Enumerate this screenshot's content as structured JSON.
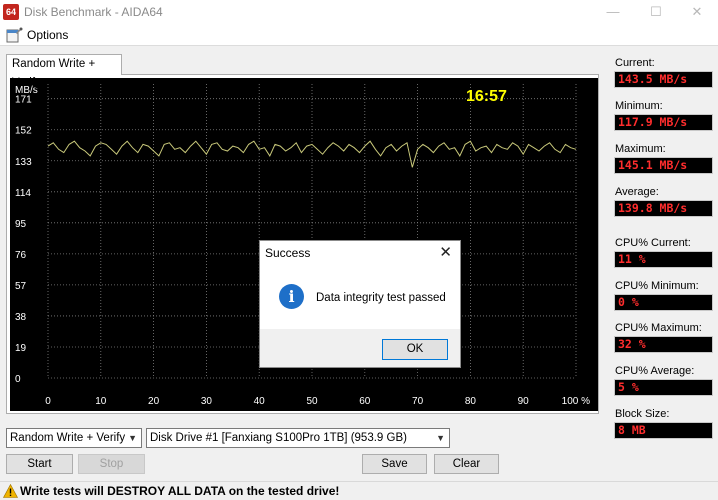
{
  "window": {
    "title": "Disk Benchmark - AIDA64",
    "icon_text": "64"
  },
  "menu": {
    "options_label": "Options"
  },
  "tab": {
    "label": "Random Write + Verify"
  },
  "chart_data": {
    "type": "line",
    "title": "",
    "xlabel": "",
    "ylabel": "MB/s",
    "x_ticks": [
      "0",
      "10",
      "20",
      "30",
      "40",
      "50",
      "60",
      "70",
      "80",
      "90",
      "100 %"
    ],
    "y_ticks": [
      "0",
      "19",
      "38",
      "57",
      "76",
      "95",
      "114",
      "133",
      "152",
      "171"
    ],
    "xlim": [
      0,
      100
    ],
    "ylim": [
      0,
      180
    ],
    "timer": "16:57",
    "line_color": "#c8c87a",
    "grid": true,
    "series": [
      {
        "values": [
          142,
          144,
          140,
          138,
          143,
          145,
          141,
          139,
          136,
          142,
          144,
          143,
          140,
          137,
          142,
          145,
          141,
          138,
          143,
          142,
          139,
          136,
          143,
          144,
          140,
          141,
          138,
          142,
          145,
          141,
          137,
          143,
          144,
          140,
          139,
          142,
          141,
          138,
          143,
          145,
          140,
          141,
          136,
          143,
          142,
          139,
          141,
          144,
          138,
          142,
          143,
          140,
          137,
          141,
          144,
          142,
          139,
          143,
          141,
          138,
          142,
          145,
          140,
          136,
          141,
          143,
          139,
          142,
          144,
          129,
          140,
          143,
          141,
          138,
          142,
          144,
          140,
          141,
          136,
          143,
          145,
          139,
          141,
          142,
          138,
          143,
          141,
          140,
          144,
          142,
          137,
          143,
          141,
          139,
          142,
          144,
          140,
          138,
          143,
          141,
          140
        ]
      }
    ]
  },
  "stats": {
    "current_label": "Current:",
    "current_value": "143.5 MB/s",
    "minimum_label": "Minimum:",
    "minimum_value": "117.9 MB/s",
    "maximum_label": "Maximum:",
    "maximum_value": "145.1 MB/s",
    "average_label": "Average:",
    "average_value": "139.8 MB/s",
    "cpu_current_label": "CPU% Current:",
    "cpu_current_value": "11 %",
    "cpu_minimum_label": "CPU% Minimum:",
    "cpu_minimum_value": "0 %",
    "cpu_maximum_label": "CPU% Maximum:",
    "cpu_maximum_value": "32 %",
    "cpu_average_label": "CPU% Average:",
    "cpu_average_value": "5 %",
    "block_size_label": "Block Size:",
    "block_size_value": "8 MB"
  },
  "controls": {
    "test_select": "Random Write + Verify",
    "drive_select": "Disk Drive #1  [Fanxiang S100Pro 1TB]  (953.9 GB)",
    "start_label": "Start",
    "stop_label": "Stop",
    "save_label": "Save",
    "clear_label": "Clear"
  },
  "warning": {
    "text": "Write tests will DESTROY ALL DATA on the tested drive!"
  },
  "dialog": {
    "title": "Success",
    "message": "Data integrity test passed",
    "ok_label": "OK"
  },
  "colors": {
    "stat_text": "#ff2d2d",
    "timer": "#ffff00",
    "grid": "#808080",
    "info_icon": "#1e6fc8",
    "warning_icon": "#f0b400",
    "app_icon": "#c2261e"
  }
}
